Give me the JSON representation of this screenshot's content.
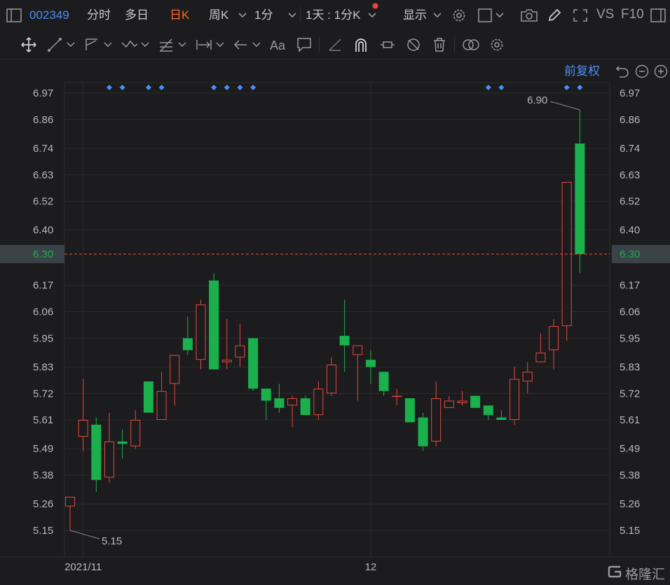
{
  "header": {
    "stock_code": "002349",
    "tabs": [
      "分时",
      "多日",
      "日K",
      "周K",
      "1分"
    ],
    "active_tab": "日K",
    "period_combo": "1天 : 1分K",
    "display_label": "显示",
    "vs_label": "VS",
    "f10_label": "F10"
  },
  "chart_header": {
    "adjust_label": "前复权"
  },
  "watermark": "格隆汇",
  "colors": {
    "up": "#e8463f",
    "down": "#1ab04c",
    "price_line": "#e0512a",
    "current_price_text": "#1ab04c",
    "accent": "#4b8df8",
    "active_tab": "#ff6a1a"
  },
  "chart_data": {
    "type": "candlestick",
    "ylim": [
      5.1,
      7.03
    ],
    "y_ticks": [
      "6.97",
      "6.86",
      "6.74",
      "6.63",
      "6.52",
      "6.40",
      "6.30",
      "6.17",
      "6.06",
      "5.95",
      "5.83",
      "5.72",
      "5.61",
      "5.49",
      "5.38",
      "5.26",
      "5.15"
    ],
    "current_price": "6.30",
    "x_labels": [
      {
        "label": "2021/11",
        "index": 1
      },
      {
        "label": "12",
        "index": 23
      }
    ],
    "max_annotation": {
      "label": "6.90",
      "index": 39,
      "value": 6.9
    },
    "min_annotation": {
      "label": "5.15",
      "index": 0,
      "value": 5.15
    },
    "event_marker_indices": [
      3,
      4,
      6,
      7,
      11,
      12,
      13,
      14,
      32,
      33,
      38,
      39
    ],
    "candles": [
      {
        "o": 5.25,
        "c": 5.29,
        "h": 5.29,
        "l": 5.15
      },
      {
        "o": 5.54,
        "c": 5.61,
        "h": 5.78,
        "l": 5.48
      },
      {
        "o": 5.59,
        "c": 5.36,
        "h": 5.62,
        "l": 5.31
      },
      {
        "o": 5.37,
        "c": 5.52,
        "h": 5.64,
        "l": 5.35
      },
      {
        "o": 5.52,
        "c": 5.51,
        "h": 5.57,
        "l": 5.45
      },
      {
        "o": 5.5,
        "c": 5.61,
        "h": 5.65,
        "l": 5.49
      },
      {
        "o": 5.77,
        "c": 5.64,
        "h": 5.77,
        "l": 5.64
      },
      {
        "o": 5.61,
        "c": 5.73,
        "h": 5.81,
        "l": 5.61
      },
      {
        "o": 5.76,
        "c": 5.88,
        "h": 5.88,
        "l": 5.67
      },
      {
        "o": 5.95,
        "c": 5.9,
        "h": 6.04,
        "l": 5.88
      },
      {
        "o": 5.86,
        "c": 6.09,
        "h": 6.11,
        "l": 5.82
      },
      {
        "o": 6.19,
        "c": 5.82,
        "h": 6.22,
        "l": 5.82
      },
      {
        "o": 5.85,
        "c": 5.86,
        "h": 6.03,
        "l": 5.82
      },
      {
        "o": 5.87,
        "c": 5.92,
        "h": 6.01,
        "l": 5.83
      },
      {
        "o": 5.95,
        "c": 5.74,
        "h": 5.95,
        "l": 5.73
      },
      {
        "o": 5.74,
        "c": 5.69,
        "h": 5.74,
        "l": 5.61
      },
      {
        "o": 5.7,
        "c": 5.66,
        "h": 5.76,
        "l": 5.64
      },
      {
        "o": 5.67,
        "c": 5.7,
        "h": 5.71,
        "l": 5.58
      },
      {
        "o": 5.7,
        "c": 5.63,
        "h": 5.71,
        "l": 5.63
      },
      {
        "o": 5.63,
        "c": 5.74,
        "h": 5.77,
        "l": 5.61
      },
      {
        "o": 5.72,
        "c": 5.84,
        "h": 5.87,
        "l": 5.71
      },
      {
        "o": 5.96,
        "c": 5.92,
        "h": 6.11,
        "l": 5.81
      },
      {
        "o": 5.88,
        "c": 5.92,
        "h": 5.92,
        "l": 5.69
      },
      {
        "o": 5.86,
        "c": 5.83,
        "h": 5.9,
        "l": 5.76
      },
      {
        "o": 5.81,
        "c": 5.73,
        "h": 5.81,
        "l": 5.71
      },
      {
        "o": 5.71,
        "c": 5.71,
        "h": 5.74,
        "l": 5.67
      },
      {
        "o": 5.7,
        "c": 5.6,
        "h": 5.7,
        "l": 5.6
      },
      {
        "o": 5.62,
        "c": 5.5,
        "h": 5.64,
        "l": 5.48
      },
      {
        "o": 5.52,
        "c": 5.7,
        "h": 5.77,
        "l": 5.5
      },
      {
        "o": 5.66,
        "c": 5.69,
        "h": 5.71,
        "l": 5.66
      },
      {
        "o": 5.68,
        "c": 5.69,
        "h": 5.73,
        "l": 5.67
      },
      {
        "o": 5.71,
        "c": 5.66,
        "h": 5.71,
        "l": 5.66
      },
      {
        "o": 5.67,
        "c": 5.63,
        "h": 5.67,
        "l": 5.61
      },
      {
        "o": 5.62,
        "c": 5.61,
        "h": 5.65,
        "l": 5.61
      },
      {
        "o": 5.61,
        "c": 5.78,
        "h": 5.83,
        "l": 5.59
      },
      {
        "o": 5.77,
        "c": 5.81,
        "h": 5.85,
        "l": 5.72
      },
      {
        "o": 5.85,
        "c": 5.89,
        "h": 5.97,
        "l": 5.85
      },
      {
        "o": 5.9,
        "c": 6.0,
        "h": 6.03,
        "l": 5.82
      },
      {
        "o": 6.0,
        "c": 6.6,
        "h": 6.6,
        "l": 5.94
      },
      {
        "o": 6.76,
        "c": 6.3,
        "h": 6.9,
        "l": 6.22
      }
    ]
  }
}
